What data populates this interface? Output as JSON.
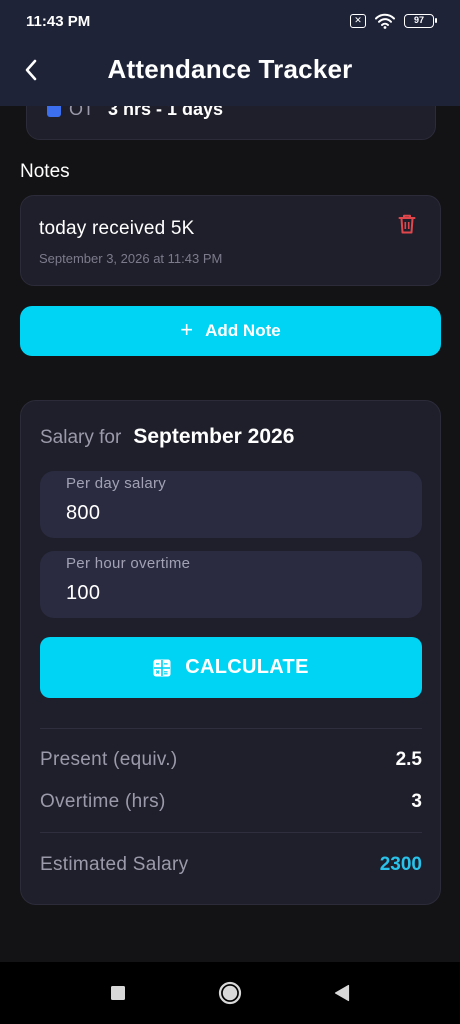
{
  "status_bar": {
    "time": "11:43 PM",
    "sim_badge": "✕",
    "battery": "97"
  },
  "app_bar": {
    "title": "Attendance Tracker"
  },
  "summary_peek": {
    "label": "OT",
    "value": "3 hrs - 1 days"
  },
  "notes": {
    "section_title": "Notes",
    "items": [
      {
        "text": "today received 5K",
        "date": "September 3, 2026 at 11:43 PM"
      }
    ],
    "add_button_label": "Add Note"
  },
  "salary": {
    "prefix": "Salary for",
    "month": "September 2026",
    "per_day_label": "Per day salary",
    "per_day_value": "800",
    "per_hour_label": "Per hour overtime",
    "per_hour_value": "100",
    "calculate_label": "CALCULATE",
    "present_label": "Present (equiv.)",
    "present_value": "2.5",
    "overtime_label": "Overtime (hrs)",
    "overtime_value": "3",
    "estimated_label": "Estimated Salary",
    "estimated_value": "2300"
  },
  "colors": {
    "accent": "#00d4f5",
    "estimated_value": "#29c2ea",
    "delete_icon": "#e0474c",
    "header_bg": "#1e2337",
    "card_bg": "#1f1f2b"
  },
  "icons": {
    "back": "chevron-left-icon",
    "delete": "trash-icon",
    "add": "plus-icon",
    "calculate": "calculator-icon",
    "nav_recents": "square-icon",
    "nav_home": "circle-icon",
    "nav_back": "triangle-icon"
  }
}
